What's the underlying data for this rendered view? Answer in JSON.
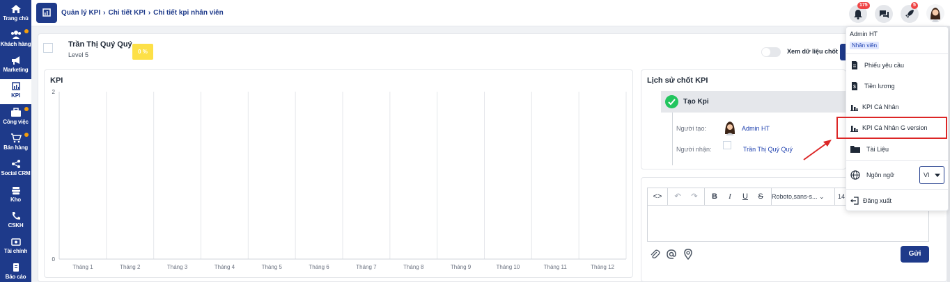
{
  "sidebar": {
    "items": [
      {
        "label": "Trang chủ",
        "icon": "home-icon",
        "dot": false
      },
      {
        "label": "Khách hàng",
        "icon": "users-icon",
        "dot": true
      },
      {
        "label": "Marketing",
        "icon": "megaphone-icon",
        "dot": false
      },
      {
        "label": "KPI",
        "icon": "bar-chart-icon",
        "dot": false,
        "active": true
      },
      {
        "label": "Công việc",
        "icon": "briefcase-icon",
        "dot": true
      },
      {
        "label": "Bán hàng",
        "icon": "cart-icon",
        "dot": true
      },
      {
        "label": "Social CRM",
        "icon": "share-icon",
        "dot": false
      },
      {
        "label": "Kho",
        "icon": "warehouse-icon",
        "dot": false
      },
      {
        "label": "CSKH",
        "icon": "phone-icon",
        "dot": false
      },
      {
        "label": "Tài chính",
        "icon": "money-icon",
        "dot": false
      },
      {
        "label": "Báo cáo",
        "icon": "report-icon",
        "dot": false
      }
    ]
  },
  "header": {
    "breadcrumb": [
      "Quản lý KPI",
      "Chi tiết KPI",
      "Chi tiết kpi nhân viên"
    ],
    "notif_count": "175",
    "rocket_count": "5"
  },
  "employee": {
    "name": "Trần Thị Quý Quý",
    "level": "Level 5",
    "kpi_percent": "0 %"
  },
  "toggle": {
    "label": "Xem dữ liệu chốt"
  },
  "kpi_card": {
    "title": "KPI"
  },
  "chart_data": {
    "type": "line",
    "title": "KPI",
    "categories": [
      "Tháng 1",
      "Tháng 2",
      "Tháng 3",
      "Tháng 4",
      "Tháng 5",
      "Tháng 6",
      "Tháng 7",
      "Tháng 8",
      "Tháng 9",
      "Tháng 10",
      "Tháng 11",
      "Tháng 12"
    ],
    "series": [],
    "ylim": [
      0,
      2
    ],
    "yticks": [
      "2",
      "0"
    ],
    "grid": true
  },
  "history": {
    "title": "Lịch sử chốt KPI",
    "event": "Tạo Kpi",
    "creator_label": "Người tạo:",
    "creator": "Admin HT",
    "receiver_label": "Người nhận:",
    "receiver": "Trần Thị Quý Quý"
  },
  "editor": {
    "font": "Roboto,sans-s...",
    "font_size": "14",
    "send_label": "Gửi"
  },
  "dropdown": {
    "user": "Admin HT",
    "role": "Nhân viên",
    "items": [
      {
        "label": "Phiếu yêu cầu",
        "icon": "document-icon"
      },
      {
        "label": "Tiền lương",
        "icon": "salary-icon"
      },
      {
        "label": "KPI Cá Nhân",
        "icon": "bar-chart-icon"
      },
      {
        "label": "KPI Cá Nhân G version",
        "icon": "bar-chart-icon"
      },
      {
        "label": "Tài Liệu",
        "icon": "folder-icon"
      }
    ],
    "language_label": "Ngôn ngữ",
    "language_value": "VI",
    "logout_label": "Đăng xuất"
  }
}
